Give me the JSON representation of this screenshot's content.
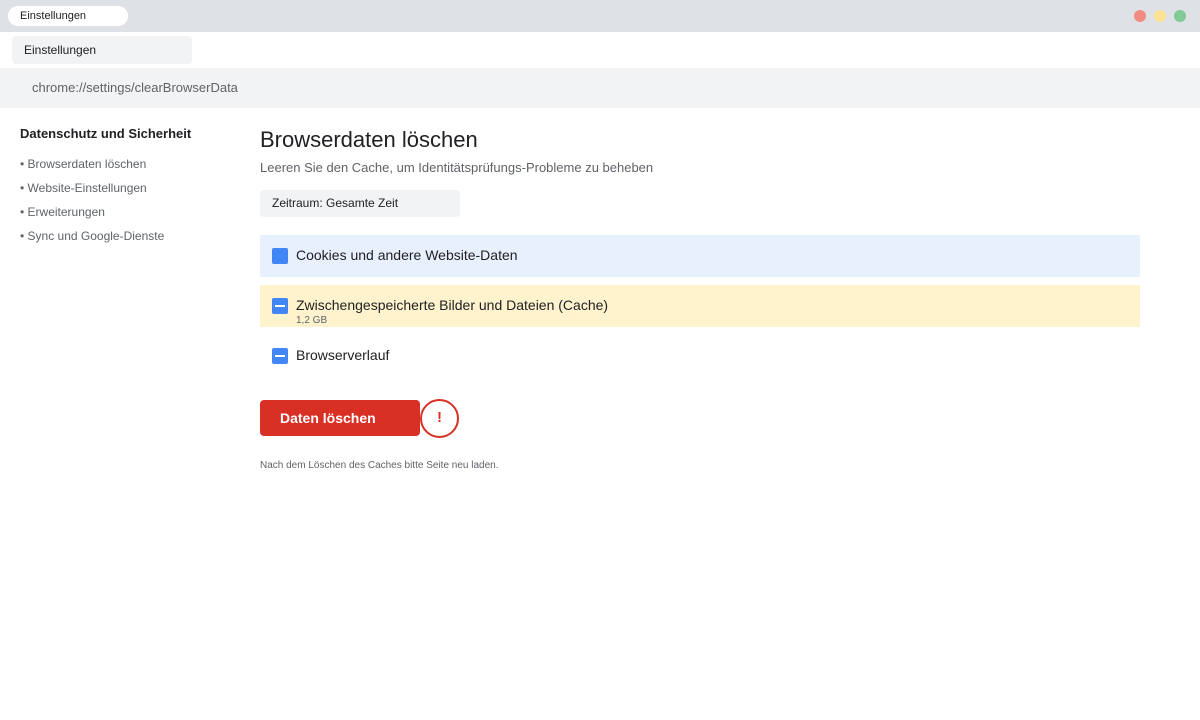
{
  "window": {
    "tab_title": "Einstellungen",
    "controls": {
      "close_color": "#f28b82",
      "minimize_color": "#fde293",
      "maximize_color": "#81c995"
    }
  },
  "toolbar": {
    "tab_label": "Einstellungen"
  },
  "address_bar": {
    "url": "chrome://settings/clearBrowserData"
  },
  "sidebar": {
    "title": "Datenschutz und Sicherheit",
    "items": [
      {
        "label": "• Browserdaten löschen"
      },
      {
        "label": "• Website-Einstellungen"
      },
      {
        "label": "• Erweiterungen"
      },
      {
        "label": "• Sync und Google-Dienste"
      }
    ]
  },
  "main": {
    "title": "Browserdaten löschen",
    "subtitle": "Leeren Sie den Cache, um Identitätsprüfungs-Probleme zu beheben",
    "time_range": "Zeitraum: Gesamte Zeit",
    "options": [
      {
        "label": "Cookies und andere Website-Daten",
        "state": "checked"
      },
      {
        "label": "Zwischengespeicherte Bilder und Dateien (Cache)",
        "detail": "1,2 GB",
        "state": "indeterminate"
      },
      {
        "label": "Browserverlauf",
        "state": "indeterminate"
      }
    ],
    "delete_button": "Daten löschen",
    "warning_symbol": "!",
    "footnote": "Nach dem Löschen des Caches bitte Seite neu laden."
  },
  "colors": {
    "accent": "#4285f4",
    "danger": "#d93025",
    "highlight_blue": "#e8f0fe",
    "highlight_yellow": "#fef3cd"
  },
  "icons": {
    "warning": "exclamation-circle-icon",
    "checkbox": "checkbox-icon"
  }
}
